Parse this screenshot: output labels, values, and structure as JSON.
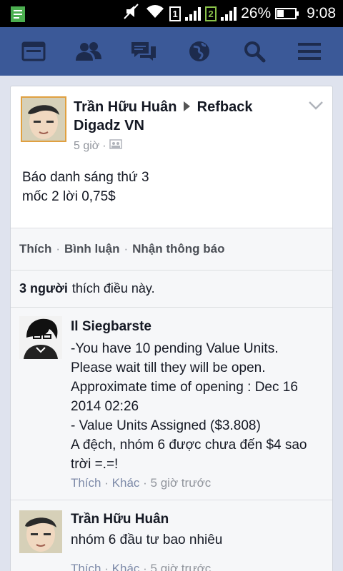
{
  "status_bar": {
    "sim1": "1",
    "sim2": "2",
    "battery": "26%",
    "time": "9:08"
  },
  "nav": {
    "items": [
      "news-feed-icon",
      "friends-icon",
      "messages-icon",
      "notifications-globe-icon",
      "search-icon",
      "menu-icon"
    ]
  },
  "post": {
    "author": "Trần Hữu Huân",
    "target": "Refback Digadz VN",
    "time": "5 giờ",
    "text_line1": "Báo danh sáng thứ 3",
    "text_line2": "mốc 2 lời 0,75$"
  },
  "actions": {
    "like": "Thích",
    "comment": "Bình luận",
    "notify": "Nhận thông báo"
  },
  "likes": {
    "count": "3 người",
    "suffix": "thích điều này."
  },
  "comments": [
    {
      "name": "Il Siegbarste",
      "text": "-You have 10 pending Value Units.\nPlease wait till they will be open.\nApproximate time of opening : Dec 16 2014 02:26\n- Value Units Assigned ($3.808)\nA đệch, nhóm 6 được chưa đến $4 sao trời =.=!",
      "like": "Thích",
      "more": "Khác",
      "time": "5 giờ trước"
    },
    {
      "name": "Trần Hữu Huân",
      "text": "nhóm 6 đầu tư bao nhiêu",
      "like": "Thích",
      "more": "Khác",
      "time": "5 giờ trước"
    }
  ],
  "colors": {
    "brand": "#3b5998",
    "status_bar": "#000000",
    "meta_text": "#90949c"
  }
}
